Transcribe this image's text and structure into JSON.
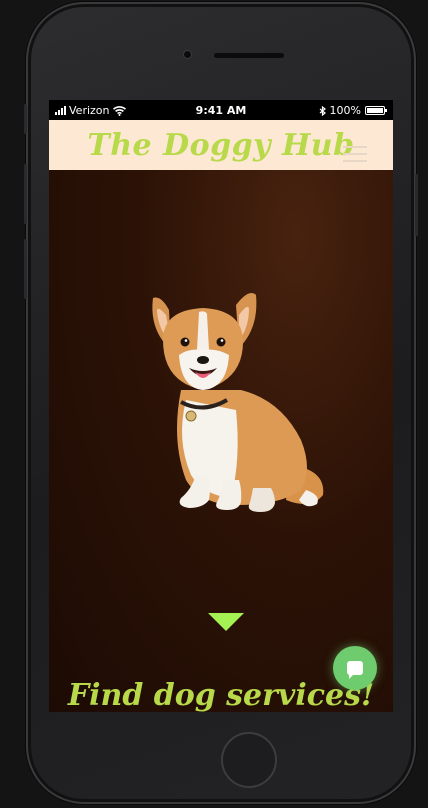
{
  "status_bar": {
    "carrier": "Verizon",
    "time": "9:41 AM",
    "battery": "100%"
  },
  "header": {
    "logo_text": "The Doggy Hub",
    "menu_icon": "hamburger-icon"
  },
  "hero": {
    "image": "corgi-illustration",
    "scroll_indicator": "triangle-down-icon",
    "cta_text": "Find dog services!"
  },
  "chat": {
    "icon": "chat-bubble-icon"
  },
  "colors": {
    "logo_green": "#b8d94a",
    "header_bg": "#fde8d3",
    "hero_bg": "#2c1206",
    "arrow_green": "#a5f052",
    "chat_green": "#6ecb6e"
  }
}
